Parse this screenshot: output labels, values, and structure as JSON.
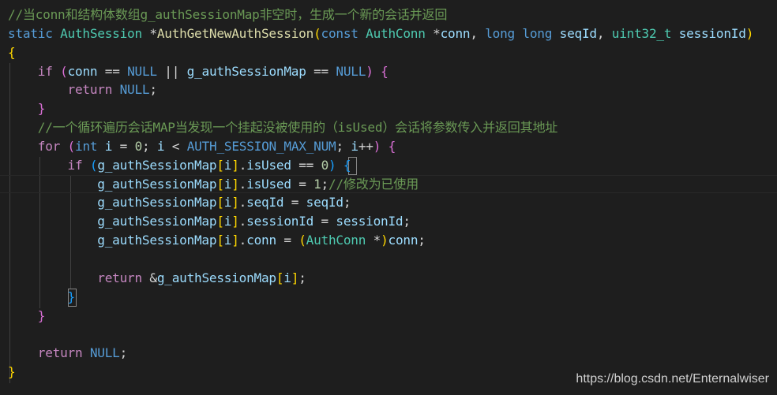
{
  "code_lines": [
    [
      {
        "t": "//当conn和结构体数组g_authSessionMap非空时，生成一个新的会话并返回",
        "c": "cmt"
      }
    ],
    [
      {
        "t": "static",
        "c": "kw"
      },
      {
        "t": " ",
        "c": "txt"
      },
      {
        "t": "AuthSession",
        "c": "type"
      },
      {
        "t": " *",
        "c": "txt"
      },
      {
        "t": "AuthGetNewAuthSession",
        "c": "fn"
      },
      {
        "t": "(",
        "c": "p1"
      },
      {
        "t": "const",
        "c": "kw"
      },
      {
        "t": " ",
        "c": "txt"
      },
      {
        "t": "AuthConn",
        "c": "type"
      },
      {
        "t": " *",
        "c": "txt"
      },
      {
        "t": "conn",
        "c": "var"
      },
      {
        "t": ", ",
        "c": "txt"
      },
      {
        "t": "long long",
        "c": "kw"
      },
      {
        "t": " ",
        "c": "txt"
      },
      {
        "t": "seqId",
        "c": "var"
      },
      {
        "t": ", ",
        "c": "txt"
      },
      {
        "t": "uint32_t",
        "c": "type"
      },
      {
        "t": " ",
        "c": "txt"
      },
      {
        "t": "sessionId",
        "c": "var"
      },
      {
        "t": ")",
        "c": "p1"
      }
    ],
    [
      {
        "t": "{",
        "c": "p1"
      }
    ],
    [
      {
        "t": "    ",
        "c": "txt"
      },
      {
        "t": "if",
        "c": "ctrl"
      },
      {
        "t": " ",
        "c": "txt"
      },
      {
        "t": "(",
        "c": "p2"
      },
      {
        "t": "conn",
        "c": "var"
      },
      {
        "t": " == ",
        "c": "txt"
      },
      {
        "t": "NULL",
        "c": "mac"
      },
      {
        "t": " || ",
        "c": "txt"
      },
      {
        "t": "g_authSessionMap",
        "c": "var"
      },
      {
        "t": " == ",
        "c": "txt"
      },
      {
        "t": "NULL",
        "c": "mac"
      },
      {
        "t": ")",
        "c": "p2"
      },
      {
        "t": " ",
        "c": "txt"
      },
      {
        "t": "{",
        "c": "p2"
      }
    ],
    [
      {
        "t": "        ",
        "c": "txt"
      },
      {
        "t": "return",
        "c": "ctrl"
      },
      {
        "t": " ",
        "c": "txt"
      },
      {
        "t": "NULL",
        "c": "mac"
      },
      {
        "t": ";",
        "c": "txt"
      }
    ],
    [
      {
        "t": "    ",
        "c": "txt"
      },
      {
        "t": "}",
        "c": "p2"
      }
    ],
    [
      {
        "t": "    ",
        "c": "txt"
      },
      {
        "t": "//一个循环遍历会话MAP当发现一个挂起没被使用的（isUsed）会话将参数传入并返回其地址",
        "c": "cmt"
      }
    ],
    [
      {
        "t": "    ",
        "c": "txt"
      },
      {
        "t": "for",
        "c": "ctrl"
      },
      {
        "t": " ",
        "c": "txt"
      },
      {
        "t": "(",
        "c": "p2"
      },
      {
        "t": "int",
        "c": "kw"
      },
      {
        "t": " ",
        "c": "txt"
      },
      {
        "t": "i",
        "c": "var"
      },
      {
        "t": " = ",
        "c": "txt"
      },
      {
        "t": "0",
        "c": "num"
      },
      {
        "t": "; ",
        "c": "txt"
      },
      {
        "t": "i",
        "c": "var"
      },
      {
        "t": " < ",
        "c": "txt"
      },
      {
        "t": "AUTH_SESSION_MAX_NUM",
        "c": "mac"
      },
      {
        "t": "; ",
        "c": "txt"
      },
      {
        "t": "i",
        "c": "var"
      },
      {
        "t": "++",
        "c": "txt"
      },
      {
        "t": ")",
        "c": "p2"
      },
      {
        "t": " ",
        "c": "txt"
      },
      {
        "t": "{",
        "c": "p2"
      }
    ],
    [
      {
        "t": "        ",
        "c": "txt"
      },
      {
        "t": "if",
        "c": "ctrl"
      },
      {
        "t": " ",
        "c": "txt"
      },
      {
        "t": "(",
        "c": "p3"
      },
      {
        "t": "g_authSessionMap",
        "c": "var"
      },
      {
        "t": "[",
        "c": "p1"
      },
      {
        "t": "i",
        "c": "var"
      },
      {
        "t": "]",
        "c": "p1"
      },
      {
        "t": ".",
        "c": "txt"
      },
      {
        "t": "isUsed",
        "c": "var"
      },
      {
        "t": " == ",
        "c": "txt"
      },
      {
        "t": "0",
        "c": "num"
      },
      {
        "t": ")",
        "c": "p3"
      },
      {
        "t": " ",
        "c": "txt"
      },
      {
        "t": "{",
        "c": "p3"
      }
    ],
    [
      {
        "t": "            ",
        "c": "txt"
      },
      {
        "t": "g_authSessionMap",
        "c": "var"
      },
      {
        "t": "[",
        "c": "p1"
      },
      {
        "t": "i",
        "c": "var"
      },
      {
        "t": "]",
        "c": "p1"
      },
      {
        "t": ".",
        "c": "txt"
      },
      {
        "t": "isUsed",
        "c": "var"
      },
      {
        "t": " = ",
        "c": "txt"
      },
      {
        "t": "1",
        "c": "num"
      },
      {
        "t": ";",
        "c": "txt"
      },
      {
        "t": "//修改为已使用",
        "c": "cmt"
      }
    ],
    [
      {
        "t": "            ",
        "c": "txt"
      },
      {
        "t": "g_authSessionMap",
        "c": "var"
      },
      {
        "t": "[",
        "c": "p1"
      },
      {
        "t": "i",
        "c": "var"
      },
      {
        "t": "]",
        "c": "p1"
      },
      {
        "t": ".",
        "c": "txt"
      },
      {
        "t": "seqId",
        "c": "var"
      },
      {
        "t": " = ",
        "c": "txt"
      },
      {
        "t": "seqId",
        "c": "var"
      },
      {
        "t": ";",
        "c": "txt"
      }
    ],
    [
      {
        "t": "            ",
        "c": "txt"
      },
      {
        "t": "g_authSessionMap",
        "c": "var"
      },
      {
        "t": "[",
        "c": "p1"
      },
      {
        "t": "i",
        "c": "var"
      },
      {
        "t": "]",
        "c": "p1"
      },
      {
        "t": ".",
        "c": "txt"
      },
      {
        "t": "sessionId",
        "c": "var"
      },
      {
        "t": " = ",
        "c": "txt"
      },
      {
        "t": "sessionId",
        "c": "var"
      },
      {
        "t": ";",
        "c": "txt"
      }
    ],
    [
      {
        "t": "            ",
        "c": "txt"
      },
      {
        "t": "g_authSessionMap",
        "c": "var"
      },
      {
        "t": "[",
        "c": "p1"
      },
      {
        "t": "i",
        "c": "var"
      },
      {
        "t": "]",
        "c": "p1"
      },
      {
        "t": ".",
        "c": "txt"
      },
      {
        "t": "conn",
        "c": "var"
      },
      {
        "t": " = ",
        "c": "txt"
      },
      {
        "t": "(",
        "c": "p1"
      },
      {
        "t": "AuthConn",
        "c": "type"
      },
      {
        "t": " *",
        "c": "txt"
      },
      {
        "t": ")",
        "c": "p1"
      },
      {
        "t": "conn",
        "c": "var"
      },
      {
        "t": ";",
        "c": "txt"
      }
    ],
    [],
    [
      {
        "t": "            ",
        "c": "txt"
      },
      {
        "t": "return",
        "c": "ctrl"
      },
      {
        "t": " &",
        "c": "txt"
      },
      {
        "t": "g_authSessionMap",
        "c": "var"
      },
      {
        "t": "[",
        "c": "p1"
      },
      {
        "t": "i",
        "c": "var"
      },
      {
        "t": "]",
        "c": "p1"
      },
      {
        "t": ";",
        "c": "txt"
      }
    ],
    [
      {
        "t": "        ",
        "c": "txt"
      },
      {
        "t": "}",
        "c": "p3"
      }
    ],
    [
      {
        "t": "    ",
        "c": "txt"
      },
      {
        "t": "}",
        "c": "p2"
      }
    ],
    [],
    [
      {
        "t": "    ",
        "c": "txt"
      },
      {
        "t": "return",
        "c": "ctrl"
      },
      {
        "t": " ",
        "c": "txt"
      },
      {
        "t": "NULL",
        "c": "mac"
      },
      {
        "t": ";",
        "c": "txt"
      }
    ],
    [
      {
        "t": "}",
        "c": "p1"
      }
    ]
  ],
  "watermark": "https://blog.csdn.net/Enternalwiser",
  "colors": {
    "background": "#1e1e1e",
    "comment": "#6a9955",
    "keyword": "#569cd6",
    "control": "#c586c0",
    "type": "#4ec9b0",
    "function": "#dcdcaa",
    "variable": "#9cdcfe",
    "number": "#b5cea8",
    "bracket_level_1": "#ffd700",
    "bracket_level_2": "#da70d6",
    "bracket_level_3": "#179fff"
  }
}
